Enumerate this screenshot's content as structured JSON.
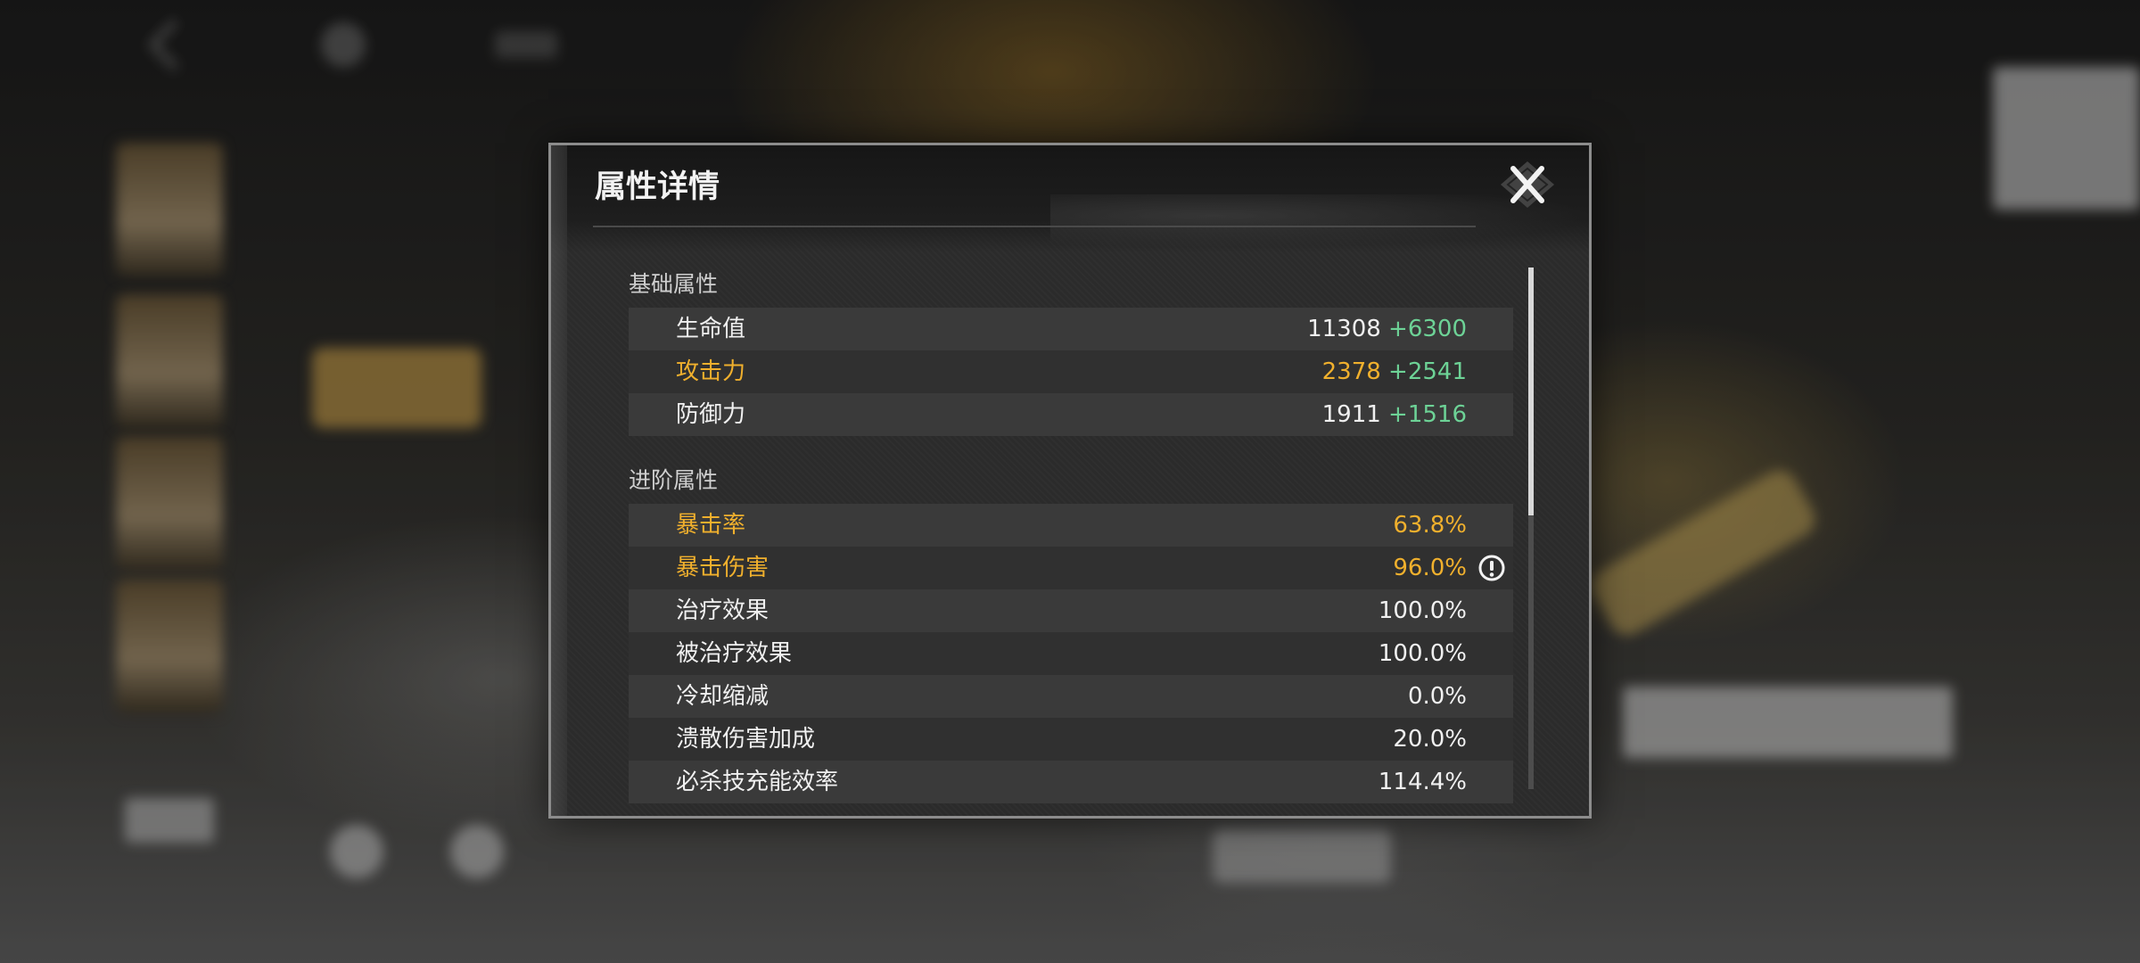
{
  "modal": {
    "title": "属性详情",
    "close_icon": "close-icon"
  },
  "basic_section": {
    "title": "基础属性",
    "rows": [
      {
        "label": "生命值",
        "base": "11308",
        "bonus": "+6300",
        "highlight": false
      },
      {
        "label": "攻击力",
        "base": "2378",
        "bonus": "+2541",
        "highlight": true
      },
      {
        "label": "防御力",
        "base": "1911",
        "bonus": "+1516",
        "highlight": false
      }
    ]
  },
  "advanced_section": {
    "title": "进阶属性",
    "rows": [
      {
        "label": "暴击率",
        "value": "63.8%",
        "highlight": true
      },
      {
        "label": "暴击伤害",
        "value": "96.0%",
        "highlight": true,
        "icon": "info-icon"
      },
      {
        "label": "治疗效果",
        "value": "100.0%",
        "highlight": false
      },
      {
        "label": "被治疗效果",
        "value": "100.0%",
        "highlight": false
      },
      {
        "label": "冷却缩减",
        "value": "0.0%",
        "highlight": false
      },
      {
        "label": "溃散伤害加成",
        "value": "20.0%",
        "highlight": false
      },
      {
        "label": "必杀技充能效率",
        "value": "114.4%",
        "highlight": false
      }
    ]
  },
  "colors": {
    "highlight": "#f0b02d",
    "bonus": "#6dd296",
    "text": "#f0f0f0"
  }
}
